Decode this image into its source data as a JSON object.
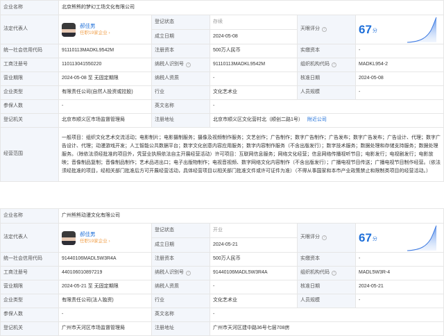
{
  "labels": {
    "company_name": "企业名称",
    "legal_rep": "法定代表人",
    "reg_status": "登记状态",
    "founded": "成立日期",
    "tianyan_score": "天眼评分",
    "credit_code": "统一社会信用代码",
    "reg_capital": "注册资本",
    "paid_capital": "实缴资本",
    "biz_reg_no": "工商注册号",
    "taxpayer_id": "纳税人识别号",
    "org_code": "组织机构代码",
    "term": "营业期限",
    "taxpayer_qual": "纳税人资质",
    "approved": "核准日期",
    "company_type": "企业类型",
    "industry": "行业",
    "staff_size": "人员规模",
    "insured": "参保人数",
    "en_name": "英文名称",
    "authority": "登记机关",
    "reg_address": "注册地址",
    "scope": "经营范围"
  },
  "score_unit": "分",
  "nearby_link": "附近公司",
  "companies": [
    {
      "name": "北京熊熊的梦幻工场文化有限公司",
      "rep_name": "郝佳男",
      "rep_sub": "任职19家企业 ›",
      "status": "存续",
      "founded": "2024-05-08",
      "score": "67",
      "credit_code": "91110113MADKL9542M",
      "reg_capital": "500万人民币",
      "paid_capital": "-",
      "biz_reg_no": "110113041550220",
      "taxpayer_id": "91110113MADKL9542M",
      "org_code": "MADKL954-2",
      "term": "2024-05-08 至 无固定期限",
      "taxpayer_qual": "-",
      "approved": "2024-05-08",
      "company_type": "有限责任公司(自然人投资或控股)",
      "industry": "文化艺术业",
      "staff_size": "-",
      "insured": "-",
      "en_name": "-",
      "authority": "北京市顺义区市场监督管理局",
      "reg_address": "北京市顺义区文化营村北（顺创二路1号）",
      "scope": "一般项目：组织文化艺术交流活动；电影制片；电影摄制服务；摄像及视频制作服务；文艺创作；广告制作；数字广告制作；广告发布；数字广告发布；广告设计、代理；数字广告设计、代理；动漫游戏开发；人工智能公共数据平台；数字文化创意内容应用服务；数字内容制作服务（不含出版发行）；数字技术服务；数据处理和存储支持服务；数据处理服务。（除依法须经批准的项目外，凭营业执照依法自主开展经营活动）许可项目：互联网信息服务；网络文化经营；信息网络传播视听节目；电影发行；电视剧发行；电影放映；音像制品复制；音像制品制作；艺术品进出口；电子出版物制作；电视音视频、数字网络文化内容制作（不含出版发行）；广播电视节目传送；广播电视节目制作经营。（依法须经批准的项目，经相关部门批准后方可开展经营活动，具体经营项目以相关部门批准文件或许可证件为准）（不得从事国家和本市产业政策禁止和限制类项目的经营活动。）"
    },
    {
      "name": "广州熊熊动漫文化有限公司",
      "rep_name": "郝佳男",
      "rep_sub": "任职19家企业 ›",
      "status": "开业",
      "founded": "2024-05-21",
      "score": "67",
      "credit_code": "91440106MADL5W3R4A",
      "reg_capital": "500万人民币",
      "paid_capital": "-",
      "biz_reg_no": "440106010897219",
      "taxpayer_id": "91440106MADL5W3R4A",
      "org_code": "MADL5W3R-4",
      "term": "2024-05-21 至 无固定期限",
      "taxpayer_qual": "-",
      "approved": "2024-05-21",
      "company_type": "有限责任公司(法人独资)",
      "industry": "文化艺术业",
      "staff_size": "-",
      "insured": "-",
      "en_name": "-",
      "authority": "广州市天河区市场监督管理局",
      "reg_address": "广州市天河区建中路36号七层708房"
    }
  ]
}
